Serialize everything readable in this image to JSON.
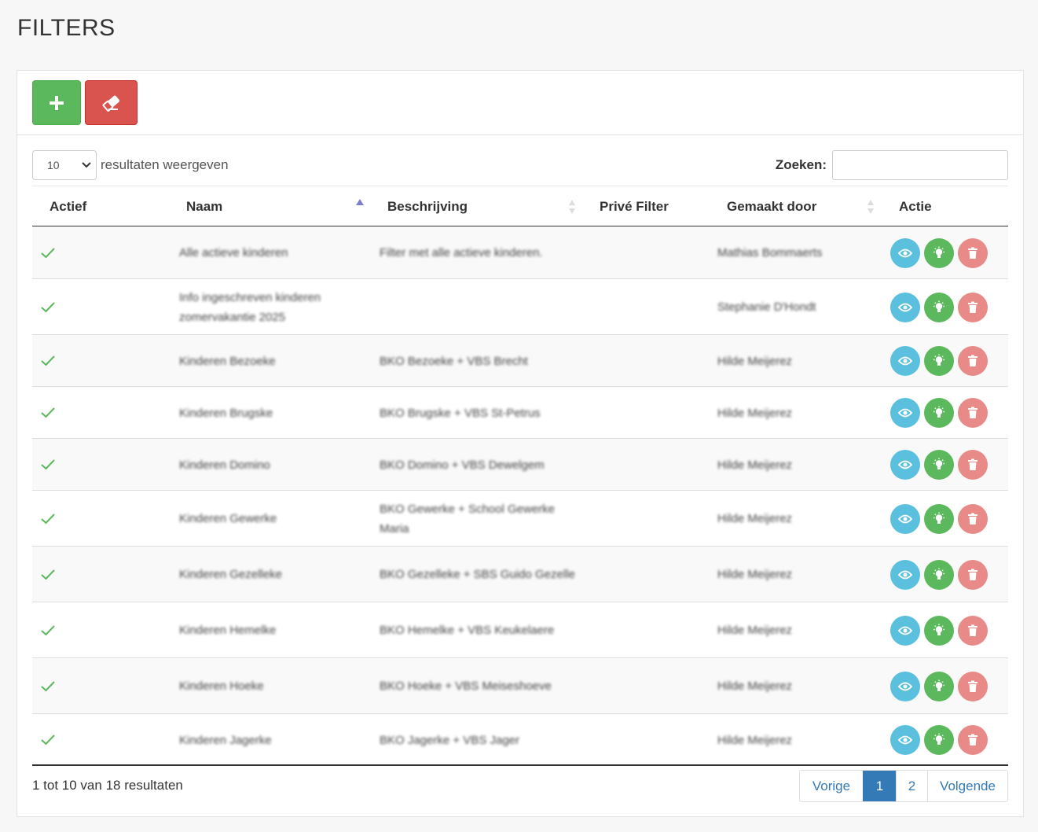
{
  "page": {
    "title": "FILTERS"
  },
  "length": {
    "value": "10",
    "label": "resultaten weergeven"
  },
  "search": {
    "label": "Zoeken:",
    "value": "",
    "placeholder": ""
  },
  "columns": {
    "actief": "Actief",
    "naam": "Naam",
    "beschrijving": "Beschrijving",
    "prive": "Privé Filter",
    "gemaakt": "Gemaakt door",
    "actie": "Actie"
  },
  "rows": [
    {
      "active": true,
      "naam": "Alle actieve kinderen",
      "beschrijving": "Filter met alle actieve kinderen.",
      "prive": "",
      "gemaakt": "Mathias Bommaerts"
    },
    {
      "active": true,
      "naam": "Info ingeschreven kinderen zomervakantie 2025",
      "beschrijving": "",
      "prive": "",
      "gemaakt": "Stephanie D'Hondt"
    },
    {
      "active": true,
      "naam": "Kinderen Bezoeke",
      "beschrijving": "BKO Bezoeke + VBS Brecht",
      "prive": "",
      "gemaakt": "Hilde Meijerez"
    },
    {
      "active": true,
      "naam": "Kinderen Brugske",
      "beschrijving": "BKO Brugske + VBS St-Petrus",
      "prive": "",
      "gemaakt": "Hilde Meijerez"
    },
    {
      "active": true,
      "naam": "Kinderen Domino",
      "beschrijving": "BKO Domino + VBS Dewelgem",
      "prive": "",
      "gemaakt": "Hilde Meijerez"
    },
    {
      "active": true,
      "naam": "Kinderen Gewerke",
      "beschrijving": "BKO Gewerke + School Gewerke Maria",
      "prive": "",
      "gemaakt": "Hilde Meijerez"
    },
    {
      "active": true,
      "naam": "Kinderen Gezelleke",
      "beschrijving": "BKO Gezelleke + SBS Guido Gezelle",
      "prive": "",
      "gemaakt": "Hilde Meijerez"
    },
    {
      "active": true,
      "naam": "Kinderen Hemelke",
      "beschrijving": "BKO Hemelke + VBS Keukelaere",
      "prive": "",
      "gemaakt": "Hilde Meijerez"
    },
    {
      "active": true,
      "naam": "Kinderen Hoeke",
      "beschrijving": "BKO Hoeke + VBS Meiseshoeve",
      "prive": "",
      "gemaakt": "Hilde Meijerez"
    },
    {
      "active": true,
      "naam": "Kinderen Jagerke",
      "beschrijving": "BKO Jagerke + VBS Jager",
      "prive": "",
      "gemaakt": "Hilde Meijerez"
    }
  ],
  "footer": {
    "info": "1 tot 10 van 18 resultaten"
  },
  "pagination": {
    "prev": "Vorige",
    "pages": [
      "1",
      "2"
    ],
    "next": "Volgende",
    "active": "1"
  },
  "colors": {
    "green": "#5cb85c",
    "red": "#d9534f",
    "info": "#5bc0de",
    "primary": "#337ab7"
  }
}
